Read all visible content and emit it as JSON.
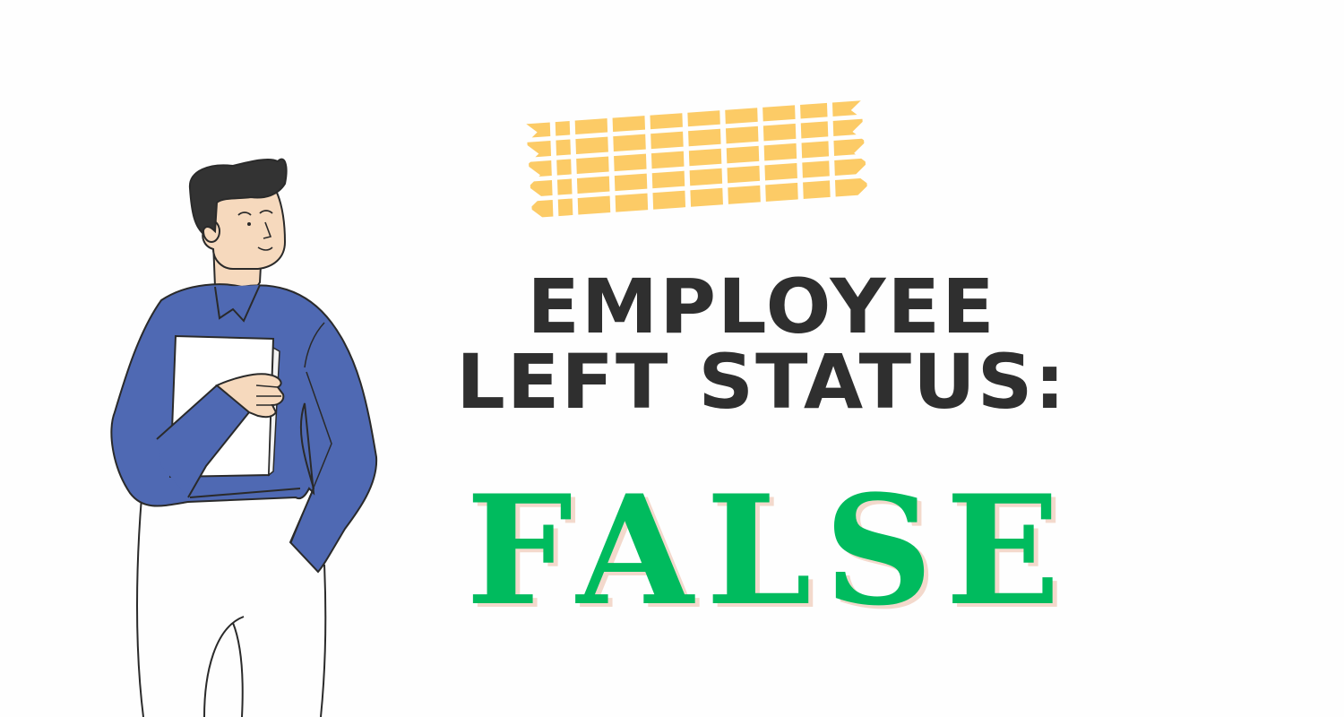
{
  "heading": {
    "line1": "EMPLOYEE",
    "line2": "LEFT STATUS:"
  },
  "status": {
    "value": "FALSE"
  },
  "colors": {
    "background": "#fefefe",
    "heading": "#2f2f2f",
    "status_value": "#00bb5e",
    "status_shadow": "#f3d9cc",
    "tape": "#fccb66",
    "sweater": "#4f69b3",
    "skin": "#f6d9bd",
    "hair": "#333333"
  },
  "graphics": {
    "illustration": "man-holding-folder",
    "decoration": "yellow-grid-tape"
  }
}
